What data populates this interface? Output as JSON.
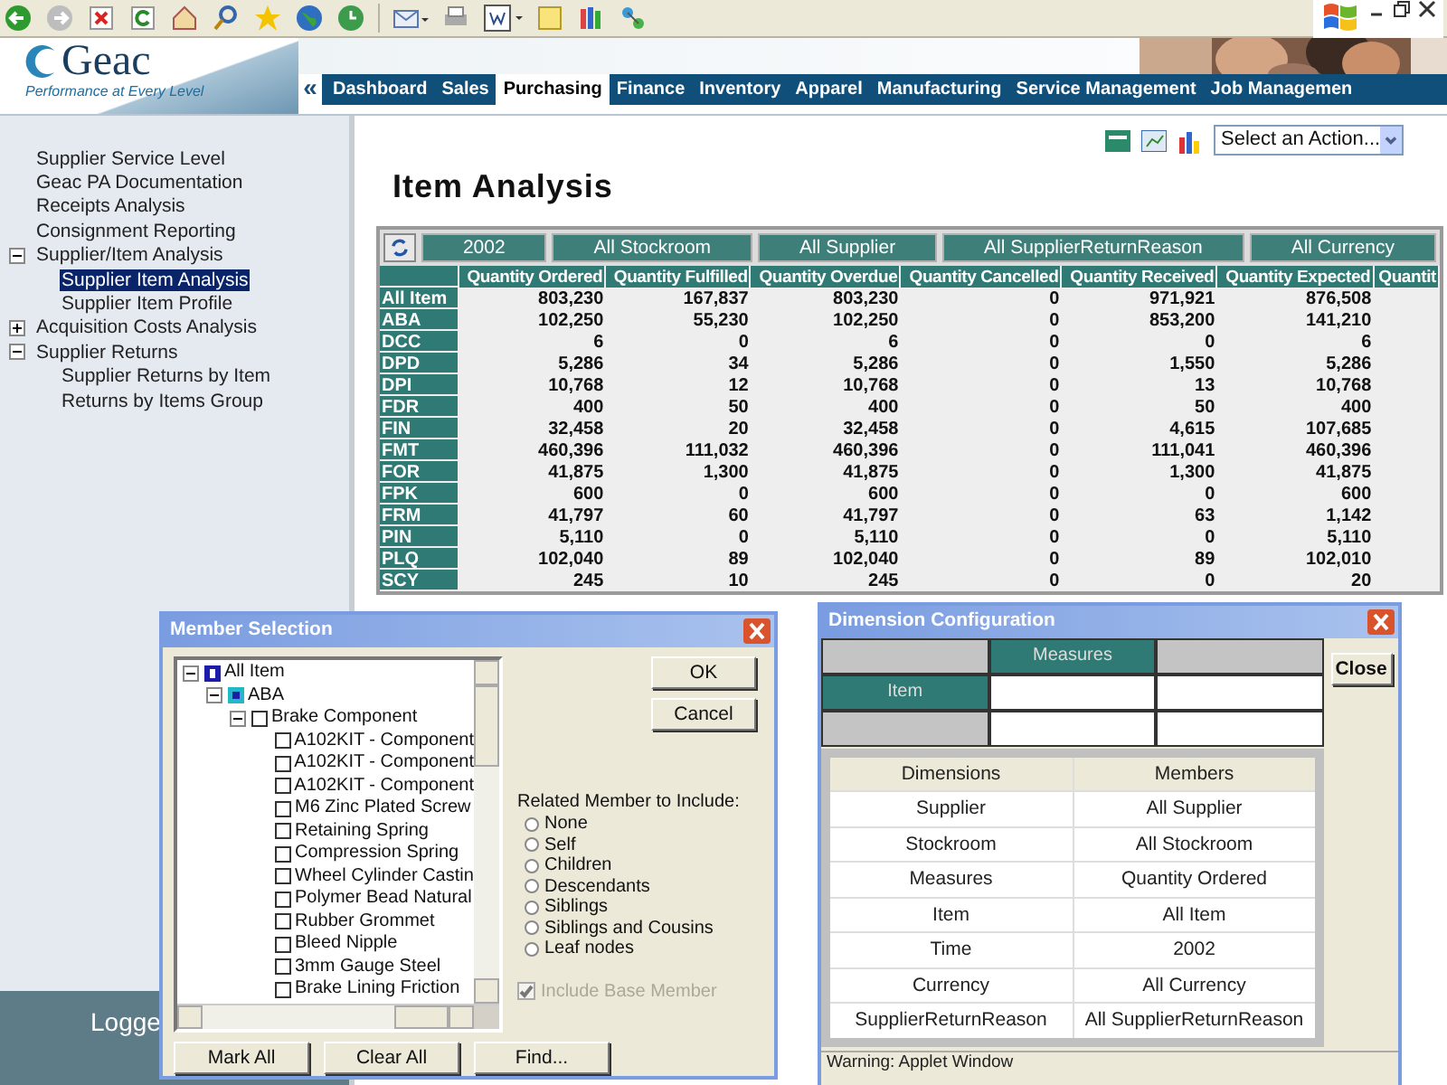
{
  "header": {
    "logo": "Geac",
    "tagline": "Performance at Every Level",
    "nav_arrow": "«",
    "nav": [
      {
        "label": "Dashboard",
        "selected": false
      },
      {
        "label": "Sales",
        "selected": false
      },
      {
        "label": "Purchasing",
        "selected": true
      },
      {
        "label": "Finance",
        "selected": false
      },
      {
        "label": "Inventory",
        "selected": false
      },
      {
        "label": "Apparel",
        "selected": false
      },
      {
        "label": "Manufacturing",
        "selected": false
      },
      {
        "label": "Service Management",
        "selected": false
      },
      {
        "label": "Job Managemen",
        "selected": false
      }
    ]
  },
  "sidebar": {
    "items": [
      {
        "label": "Supplier Service Level",
        "selected": false
      },
      {
        "label": "Geac PA Documentation",
        "selected": false
      },
      {
        "label": "Receipts Analysis",
        "selected": false
      },
      {
        "label": "Consignment Reporting",
        "selected": false
      },
      {
        "label": "Supplier/Item Analysis",
        "selected": false,
        "expanded": true,
        "children": [
          {
            "label": "Supplier Item Analysis",
            "selected": true
          },
          {
            "label": "Supplier Item Profile",
            "selected": false
          }
        ]
      },
      {
        "label": "Acquisition Costs Analysis",
        "selected": false,
        "expanded": false
      },
      {
        "label": "Supplier Returns",
        "selected": false,
        "expanded": true,
        "children": [
          {
            "label": "Supplier Returns by Item",
            "selected": false
          },
          {
            "label": "Returns by Items Group",
            "selected": false
          }
        ]
      }
    ],
    "footer": "Logge"
  },
  "action_select": {
    "value": "Select an Action..."
  },
  "page_title": "Item Analysis",
  "grid": {
    "filters": [
      "2002",
      "All Stockroom",
      "All Supplier",
      "All SupplierReturnReason",
      "All Currency"
    ],
    "columns": [
      "Quantity Ordered",
      "Quantity Fulfilled",
      "Quantity Overdue",
      "Quantity Cancelled",
      "Quantity Received",
      "Quantity Expected",
      "Quantit"
    ],
    "rows": [
      {
        "label": "All Item",
        "cells": [
          "803,230",
          "167,837",
          "803,230",
          "0",
          "971,921",
          "876,508"
        ]
      },
      {
        "label": "ABA",
        "cells": [
          "102,250",
          "55,230",
          "102,250",
          "0",
          "853,200",
          "141,210"
        ]
      },
      {
        "label": "DCC",
        "cells": [
          "6",
          "0",
          "6",
          "0",
          "0",
          "6"
        ]
      },
      {
        "label": "DPD",
        "cells": [
          "5,286",
          "34",
          "5,286",
          "0",
          "1,550",
          "5,286"
        ]
      },
      {
        "label": "DPI",
        "cells": [
          "10,768",
          "12",
          "10,768",
          "0",
          "13",
          "10,768"
        ]
      },
      {
        "label": "FDR",
        "cells": [
          "400",
          "50",
          "400",
          "0",
          "50",
          "400"
        ]
      },
      {
        "label": "FIN",
        "cells": [
          "32,458",
          "20",
          "32,458",
          "0",
          "4,615",
          "107,685"
        ]
      },
      {
        "label": "FMT",
        "cells": [
          "460,396",
          "111,032",
          "460,396",
          "0",
          "111,041",
          "460,396"
        ]
      },
      {
        "label": "FOR",
        "cells": [
          "41,875",
          "1,300",
          "41,875",
          "0",
          "1,300",
          "41,875"
        ]
      },
      {
        "label": "FPK",
        "cells": [
          "600",
          "0",
          "600",
          "0",
          "0",
          "600"
        ]
      },
      {
        "label": "FRM",
        "cells": [
          "41,797",
          "60",
          "41,797",
          "0",
          "63",
          "1,142"
        ]
      },
      {
        "label": "PIN",
        "cells": [
          "5,110",
          "0",
          "5,110",
          "0",
          "0",
          "5,110"
        ]
      },
      {
        "label": "PLQ",
        "cells": [
          "102,040",
          "89",
          "102,040",
          "0",
          "89",
          "102,010"
        ]
      },
      {
        "label": "SCY",
        "cells": [
          "245",
          "10",
          "245",
          "0",
          "0",
          "20"
        ]
      }
    ]
  },
  "member_dialog": {
    "title": "Member Selection",
    "tree": [
      {
        "label": "All Item",
        "kind": "root",
        "expanded": true,
        "children": [
          {
            "label": "ABA",
            "kind": "group",
            "expanded": true,
            "children": [
              {
                "label": "Brake Component",
                "kind": "member",
                "checked": false,
                "expanded": true,
                "children": [
                  {
                    "label": "A102KIT - Component",
                    "kind": "member",
                    "checked": false
                  },
                  {
                    "label": "A102KIT - Component",
                    "kind": "member",
                    "checked": false
                  },
                  {
                    "label": "A102KIT - Component",
                    "kind": "member",
                    "checked": false
                  },
                  {
                    "label": "M6 Zinc Plated Screw",
                    "kind": "member",
                    "checked": false
                  },
                  {
                    "label": "Retaining Spring",
                    "kind": "member",
                    "checked": false
                  },
                  {
                    "label": "Compression Spring",
                    "kind": "member",
                    "checked": false
                  },
                  {
                    "label": "Wheel Cylinder Castin",
                    "kind": "member",
                    "checked": false
                  },
                  {
                    "label": "Polymer Bead Natural",
                    "kind": "member",
                    "checked": false
                  },
                  {
                    "label": "Rubber Grommet",
                    "kind": "member",
                    "checked": false
                  },
                  {
                    "label": "Bleed Nipple",
                    "kind": "member",
                    "checked": false
                  },
                  {
                    "label": "3mm Gauge Steel",
                    "kind": "member",
                    "checked": false
                  },
                  {
                    "label": "Brake Lining Friction",
                    "kind": "member",
                    "checked": false
                  }
                ]
              }
            ]
          }
        ]
      }
    ],
    "side_buttons": [
      "OK",
      "Cancel"
    ],
    "related_label": "Related Member to Include:",
    "options": [
      {
        "label": "None",
        "selected": false
      },
      {
        "label": "Self",
        "selected": false
      },
      {
        "label": "Children",
        "selected": false
      },
      {
        "label": "Descendants",
        "selected": false
      },
      {
        "label": "Siblings",
        "selected": false
      },
      {
        "label": "Siblings and Cousins",
        "selected": false
      },
      {
        "label": "Leaf nodes",
        "selected": false
      }
    ],
    "include_base": {
      "label": "Include Base Member",
      "checked": true,
      "disabled": true
    },
    "bottom_buttons": [
      "Mark All",
      "Clear All",
      "Find..."
    ]
  },
  "dimension_dialog": {
    "title": "Dimension Configuration",
    "column_axis": "Measures",
    "row_axis": "Item",
    "close": "Close",
    "columns": [
      "Dimensions",
      "Members"
    ],
    "rows": [
      [
        "Supplier",
        "All Supplier"
      ],
      [
        "Stockroom",
        "All Stockroom"
      ],
      [
        "Measures",
        "Quantity Ordered"
      ],
      [
        "Item",
        "All Item"
      ],
      [
        "Time",
        "2002"
      ],
      [
        "Currency",
        "All Currency"
      ],
      [
        "SupplierReturnReason",
        "All SupplierReturnReason"
      ]
    ],
    "status": "Warning: Applet Window"
  }
}
